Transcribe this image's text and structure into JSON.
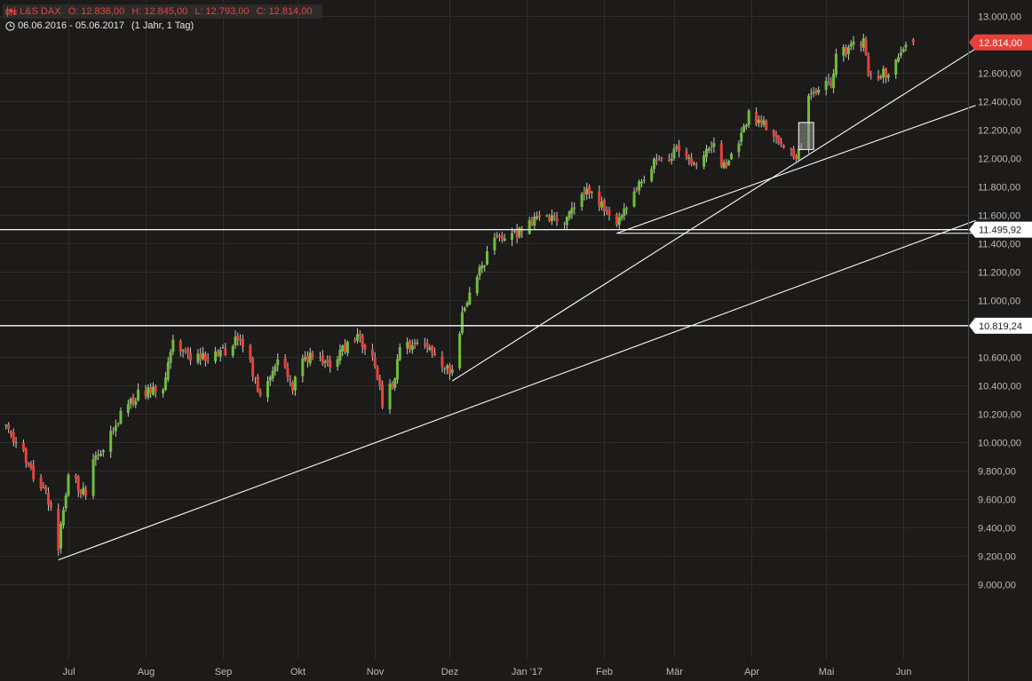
{
  "header": {
    "instrument": "L&S DAX",
    "open": "O: 12.836,00",
    "high": "H: 12.845,00",
    "low": "L: 12.793,00",
    "close": "C: 12.814,00",
    "range": "06.06.2016 - 05.06.2017",
    "period": "(1 Jahr, 1 Tag)",
    "icons": [
      "candlestick-icon",
      "clock-icon"
    ]
  },
  "colors": {
    "background": "#1c1b1a",
    "up": "#6fbe3a",
    "down": "#e8413c",
    "grid": "#2e2d2c",
    "line": "#ffffff",
    "current_price_tag": "#e8413c"
  },
  "chart_data": {
    "type": "candlestick",
    "title": "",
    "xlabel": "",
    "ylabel": "",
    "ylim": [
      9000,
      13100
    ],
    "x_range": [
      "2016-06-06",
      "2017-06-05"
    ],
    "x_ticks": [
      {
        "date": "2016-07-01",
        "label": "Jul"
      },
      {
        "date": "2016-08-01",
        "label": "Aug"
      },
      {
        "date": "2016-09-01",
        "label": "Sep"
      },
      {
        "date": "2016-10-01",
        "label": "Okt"
      },
      {
        "date": "2016-11-01",
        "label": "Nov"
      },
      {
        "date": "2016-12-01",
        "label": "Dez"
      },
      {
        "date": "2017-01-01",
        "label": "Jan '17"
      },
      {
        "date": "2017-02-01",
        "label": "Feb"
      },
      {
        "date": "2017-03-01",
        "label": "Mär"
      },
      {
        "date": "2017-04-01",
        "label": "Apr"
      },
      {
        "date": "2017-05-01",
        "label": "Mai"
      },
      {
        "date": "2017-06-01",
        "label": "Jun"
      }
    ],
    "y_ticks": [
      {
        "value": 9000,
        "label": "9.000,00"
      },
      {
        "value": 9200,
        "label": "9.200,00"
      },
      {
        "value": 9400,
        "label": "9.400,00"
      },
      {
        "value": 9600,
        "label": "9.600,00"
      },
      {
        "value": 9800,
        "label": "9.800,00"
      },
      {
        "value": 10000,
        "label": "10.000,00"
      },
      {
        "value": 10200,
        "label": "10.200,00"
      },
      {
        "value": 10400,
        "label": "10.400,00"
      },
      {
        "value": 10600,
        "label": "10.600,00"
      },
      {
        "value": 11000,
        "label": "11.000,00"
      },
      {
        "value": 11200,
        "label": "11.200,00"
      },
      {
        "value": 11400,
        "label": "11.400,00"
      },
      {
        "value": 11600,
        "label": "11.600,00"
      },
      {
        "value": 11800,
        "label": "11.800,00"
      },
      {
        "value": 12000,
        "label": "12.000,00"
      },
      {
        "value": 12200,
        "label": "12.200,00"
      },
      {
        "value": 12400,
        "label": "12.400,00"
      },
      {
        "value": 12600,
        "label": "12.600,00"
      },
      {
        "value": 13000,
        "label": "13.000,00"
      }
    ],
    "price_labels": [
      {
        "value": 12814,
        "label": "12.814,00",
        "kind": "current"
      },
      {
        "value": 11495.92,
        "label": "11.495,92",
        "kind": "level"
      },
      {
        "value": 10819.24,
        "label": "10.819,24",
        "kind": "level"
      }
    ],
    "horizontal_lines": [
      11495.92,
      10819.24
    ],
    "trend_lines": [
      {
        "from": [
          "2016-06-27",
          9170
        ],
        "to": [
          "2017-06-30",
          11560
        ]
      },
      {
        "from": [
          "2016-12-02",
          10430
        ],
        "to": [
          "2017-06-30",
          12770
        ]
      },
      {
        "from": [
          "2017-02-06",
          11470
        ],
        "to": [
          "2017-06-30",
          12370
        ]
      },
      {
        "from": [
          "2017-02-06",
          11470
        ],
        "to": [
          "2017-06-30",
          11470
        ]
      }
    ],
    "highlight_box": {
      "from": "2017-04-20",
      "to": "2017-04-26",
      "low": 12060,
      "high": 12250
    },
    "key_points": [
      {
        "date": "2016-06-06",
        "value": 10120
      },
      {
        "date": "2016-06-24",
        "value": 9560
      },
      {
        "date": "2016-06-27",
        "value": 9270
      },
      {
        "date": "2016-07-01",
        "value": 9780
      },
      {
        "date": "2016-07-08",
        "value": 9630
      },
      {
        "date": "2016-07-11",
        "value": 9850
      },
      {
        "date": "2016-07-20",
        "value": 10140
      },
      {
        "date": "2016-07-29",
        "value": 10330
      },
      {
        "date": "2016-08-08",
        "value": 10400
      },
      {
        "date": "2016-08-12",
        "value": 10720
      },
      {
        "date": "2016-08-19",
        "value": 10570
      },
      {
        "date": "2016-09-02",
        "value": 10640
      },
      {
        "date": "2016-09-08",
        "value": 10750
      },
      {
        "date": "2016-09-16",
        "value": 10330
      },
      {
        "date": "2016-09-23",
        "value": 10600
      },
      {
        "date": "2016-09-29",
        "value": 10380
      },
      {
        "date": "2016-10-04",
        "value": 10610
      },
      {
        "date": "2016-10-14",
        "value": 10560
      },
      {
        "date": "2016-10-24",
        "value": 10750
      },
      {
        "date": "2016-10-31",
        "value": 10640
      },
      {
        "date": "2016-11-04",
        "value": 10260
      },
      {
        "date": "2016-11-09",
        "value": 10460
      },
      {
        "date": "2016-11-11",
        "value": 10660
      },
      {
        "date": "2016-11-21",
        "value": 10690
      },
      {
        "date": "2016-12-01",
        "value": 10480
      },
      {
        "date": "2016-12-02",
        "value": 10510
      },
      {
        "date": "2016-12-07",
        "value": 10980
      },
      {
        "date": "2016-12-13",
        "value": 11210
      },
      {
        "date": "2016-12-20",
        "value": 11460
      },
      {
        "date": "2016-12-30",
        "value": 11480
      },
      {
        "date": "2017-01-04",
        "value": 11590
      },
      {
        "date": "2017-01-16",
        "value": 11570
      },
      {
        "date": "2017-01-25",
        "value": 11810
      },
      {
        "date": "2017-02-06",
        "value": 11520
      },
      {
        "date": "2017-02-14",
        "value": 11780
      },
      {
        "date": "2017-02-21",
        "value": 11960
      },
      {
        "date": "2017-03-02",
        "value": 12050
      },
      {
        "date": "2017-03-09",
        "value": 11940
      },
      {
        "date": "2017-03-17",
        "value": 12100
      },
      {
        "date": "2017-03-22",
        "value": 11900
      },
      {
        "date": "2017-03-31",
        "value": 12310
      },
      {
        "date": "2017-04-07",
        "value": 12220
      },
      {
        "date": "2017-04-18",
        "value": 12000
      },
      {
        "date": "2017-04-21",
        "value": 12050
      },
      {
        "date": "2017-04-24",
        "value": 12450
      },
      {
        "date": "2017-05-03",
        "value": 12520
      },
      {
        "date": "2017-05-05",
        "value": 12720
      },
      {
        "date": "2017-05-12",
        "value": 12780
      },
      {
        "date": "2017-05-16",
        "value": 12830
      },
      {
        "date": "2017-05-18",
        "value": 12570
      },
      {
        "date": "2017-05-26",
        "value": 12600
      },
      {
        "date": "2017-06-02",
        "value": 12820
      },
      {
        "date": "2017-06-05",
        "value": 12814
      }
    ]
  }
}
